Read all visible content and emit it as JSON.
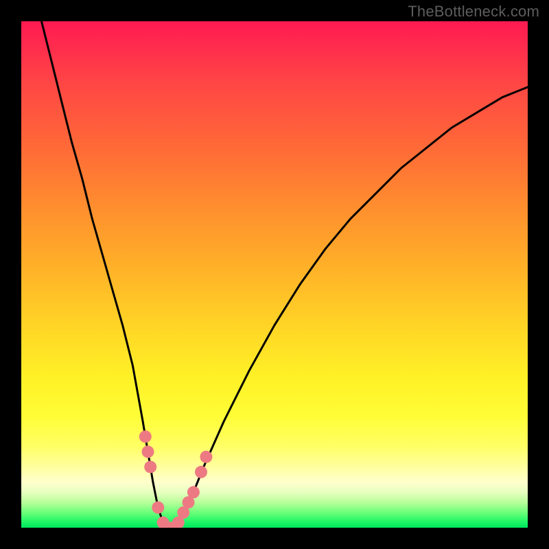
{
  "watermark": "TheBottleneck.com",
  "colors": {
    "frame": "#000000",
    "curve_stroke": "#000000",
    "marker_fill": "#ed7a82",
    "gradient_top": "#ff1a52",
    "gradient_bottom": "#00e45c"
  },
  "chart_data": {
    "type": "line",
    "title": "",
    "xlabel": "",
    "ylabel": "",
    "xlim": [
      0,
      100
    ],
    "ylim": [
      0,
      100
    ],
    "notes": "Background hue encodes y-value (red≈100 high bottleneck, green≈0 low bottleneck). Black curve shows bottleneck vs x. Pink markers sit near the minimum region.",
    "series": [
      {
        "name": "bottleneck-curve",
        "x": [
          4,
          6,
          8,
          10,
          12,
          14,
          16,
          18,
          20,
          22,
          24,
          25,
          26,
          27,
          28,
          29,
          30,
          31,
          32,
          34,
          36,
          40,
          45,
          50,
          55,
          60,
          65,
          70,
          75,
          80,
          85,
          90,
          95,
          100
        ],
        "y": [
          100,
          92,
          84,
          76,
          69,
          61,
          54,
          47,
          40,
          32,
          21,
          15,
          9,
          4,
          1,
          0,
          0,
          1,
          3,
          7,
          12,
          21,
          31,
          40,
          48,
          55,
          61,
          66,
          71,
          75,
          79,
          82,
          85,
          87
        ]
      }
    ],
    "markers": [
      {
        "x": 24.5,
        "y": 18
      },
      {
        "x": 25.0,
        "y": 15
      },
      {
        "x": 25.5,
        "y": 12
      },
      {
        "x": 27.0,
        "y": 4
      },
      {
        "x": 28.0,
        "y": 1
      },
      {
        "x": 29.0,
        "y": 0
      },
      {
        "x": 30.0,
        "y": 0
      },
      {
        "x": 31.0,
        "y": 1
      },
      {
        "x": 32.0,
        "y": 3
      },
      {
        "x": 33.0,
        "y": 5
      },
      {
        "x": 34.0,
        "y": 7
      },
      {
        "x": 35.5,
        "y": 11
      },
      {
        "x": 36.5,
        "y": 14
      }
    ]
  }
}
